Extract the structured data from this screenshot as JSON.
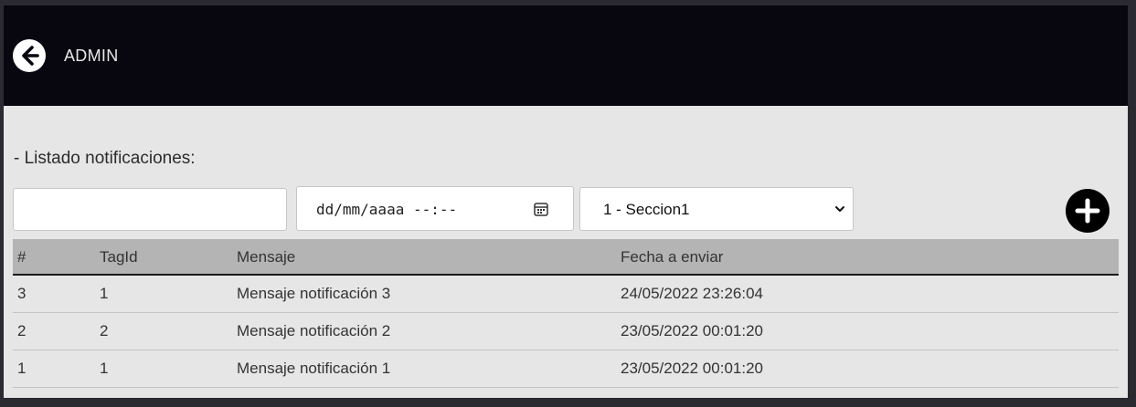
{
  "header": {
    "title": "ADMIN",
    "back_icon": "arrow-left-circle-icon"
  },
  "list": {
    "title": "- Listado notificaciones:"
  },
  "filters": {
    "text_value": "",
    "datetime_placeholder": "dd/mm/aaaa --:--",
    "calendar_icon": "calendar-icon",
    "section_selected": "1 - Seccion1",
    "add_icon": "plus-circle-icon"
  },
  "table": {
    "columns": [
      "#",
      "TagId",
      "Mensaje",
      "Fecha a enviar"
    ],
    "rows": [
      [
        "3",
        "1",
        "Mensaje notificación 3",
        "24/05/2022 23:26:04"
      ],
      [
        "2",
        "2",
        "Mensaje notificación 2",
        "23/05/2022 00:01:20"
      ],
      [
        "1",
        "1",
        "Mensaje notificación 1",
        "23/05/2022 00:01:20"
      ]
    ]
  },
  "colors": {
    "header_bg": "#08070f",
    "content_bg": "#e6e6e6",
    "table_header_bg": "#b4b4b4"
  }
}
